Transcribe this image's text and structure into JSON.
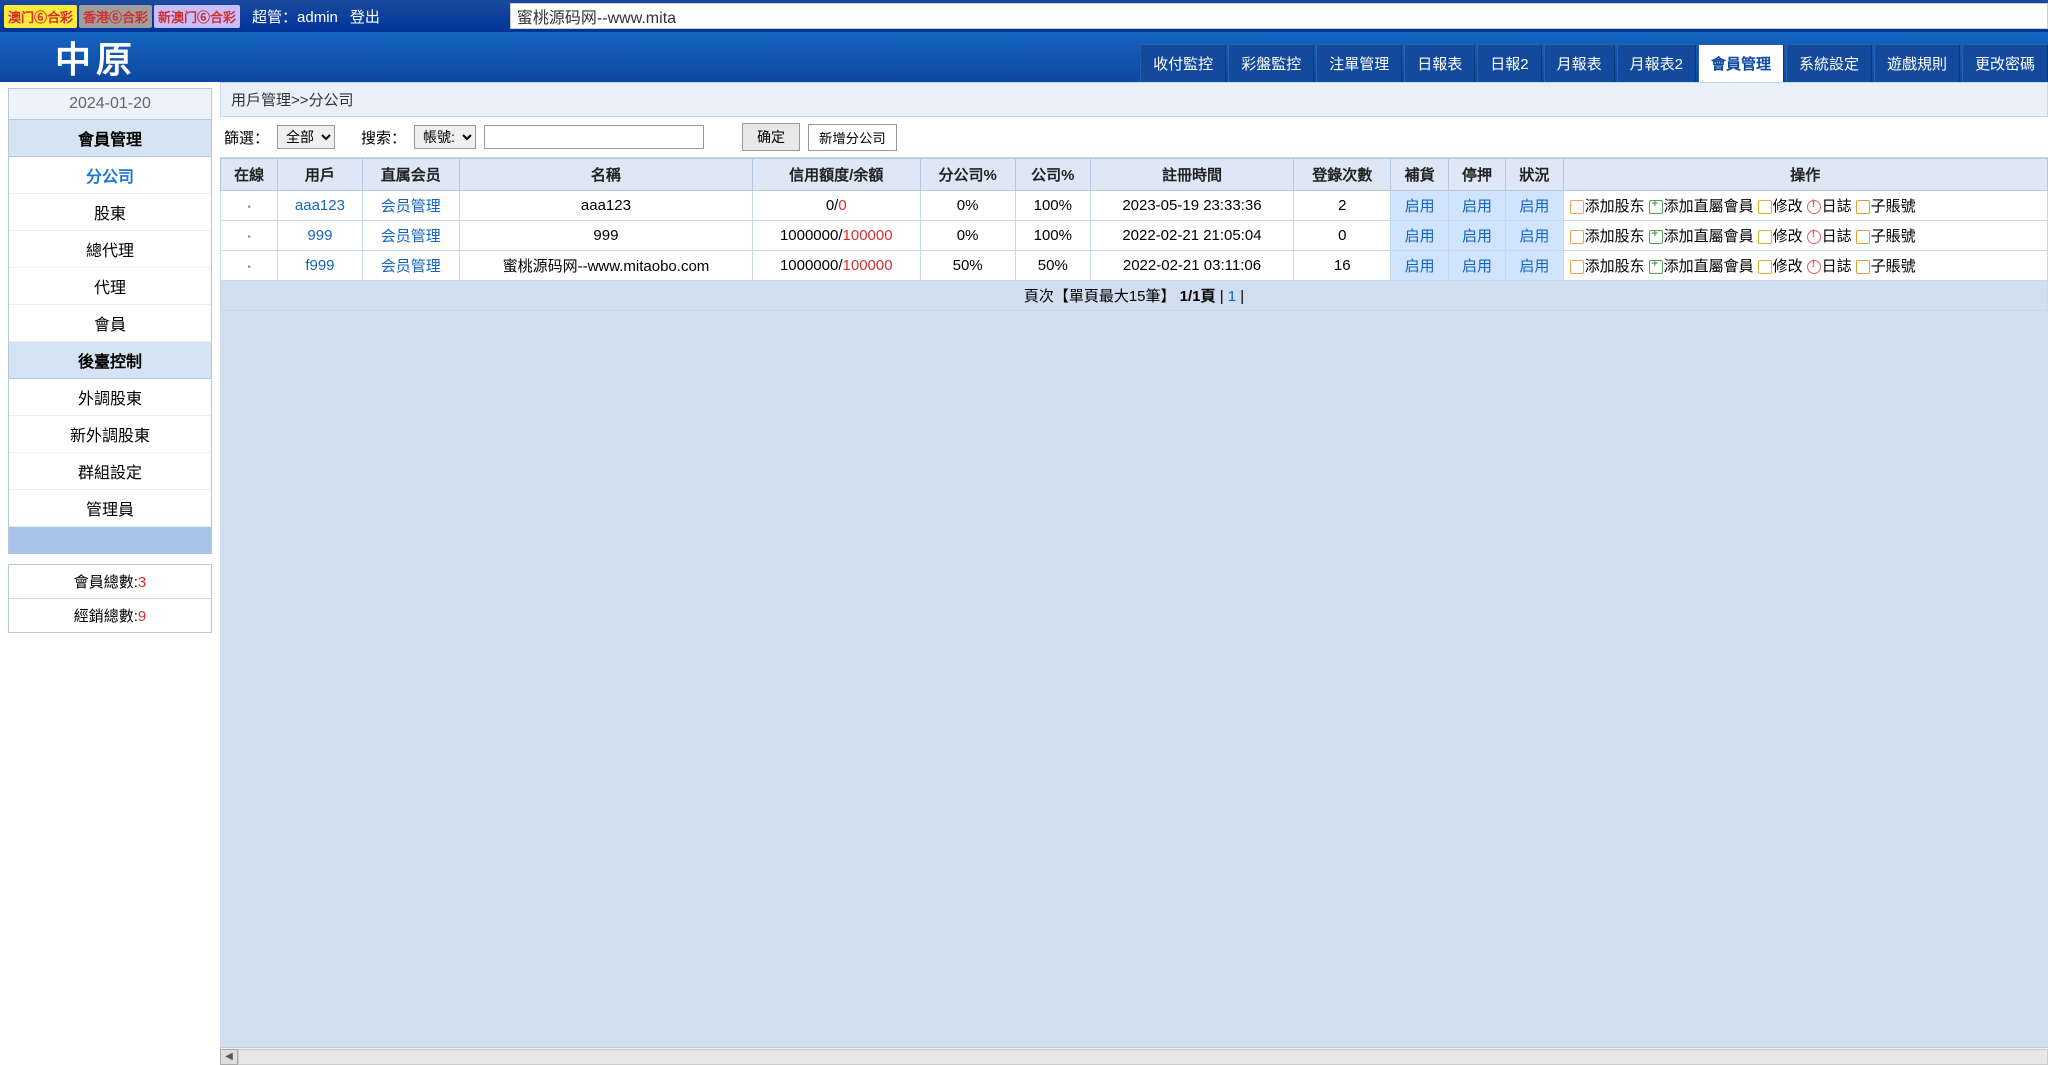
{
  "top": {
    "tags": [
      "澳门⑥合彩",
      "香港⑥合彩",
      "新澳门⑥合彩"
    ],
    "admin_label": "超管：admin",
    "logout": "登出",
    "search_value": "蜜桃源码网--www.mita"
  },
  "nav": {
    "logo": "中原",
    "tabs": [
      "收付監控",
      "彩盤監控",
      "注單管理",
      "日報表",
      "日報2",
      "月報表",
      "月報表2",
      "會員管理",
      "系統設定",
      "遊戲規則",
      "更改密碼"
    ],
    "active_index": 7
  },
  "sidebar": {
    "date": "2024-01-20",
    "member_header": "會員管理",
    "member_items": [
      "分公司",
      "股東",
      "總代理",
      "代理",
      "會員"
    ],
    "member_active": 0,
    "backend_header": "後臺控制",
    "backend_items": [
      "外調股東",
      "新外調股東",
      "群組設定",
      "管理員"
    ],
    "total_members_label": "會員總數:",
    "total_members": "3",
    "total_dealers_label": "經銷總數:",
    "total_dealers": "9"
  },
  "breadcrumb": "用戶管理>>分公司",
  "filter": {
    "filter_label": "篩選：",
    "filter_value": "全部",
    "search_label": "搜索：",
    "search_type": "帳號:",
    "confirm": "确定",
    "add_branch": "新增分公司"
  },
  "table": {
    "headers": [
      "在線",
      "用戶",
      "直属会员",
      "名稱",
      "信用額度/余額",
      "分公司%",
      "公司%",
      "註冊時間",
      "登錄次數",
      "補貨",
      "停押",
      "狀況",
      "操作"
    ],
    "rows": [
      {
        "online": "•",
        "user": "aaa123",
        "direct": "会员管理",
        "name": "aaa123",
        "credit": "0",
        "balance": "0",
        "branch_pct": "0%",
        "co_pct": "100%",
        "reg": "2023-05-19 23:33:36",
        "logins": "2",
        "buhuo": "启用",
        "tingya": "启用",
        "status": "启用"
      },
      {
        "online": "•",
        "user": "999",
        "direct": "会员管理",
        "name": "999",
        "credit": "1000000",
        "balance": "100000",
        "branch_pct": "0%",
        "co_pct": "100%",
        "reg": "2022-02-21 21:05:04",
        "logins": "0",
        "buhuo": "启用",
        "tingya": "启用",
        "status": "启用"
      },
      {
        "online": "•",
        "user": "f999",
        "direct": "会员管理",
        "name": "蜜桃源码网--www.mitaobo.com",
        "credit": "1000000",
        "balance": "100000",
        "branch_pct": "50%",
        "co_pct": "50%",
        "reg": "2022-02-21 03:11:06",
        "logins": "16",
        "buhuo": "启用",
        "tingya": "启用",
        "status": "启用"
      }
    ],
    "ops": {
      "add_share": "添加股东",
      "add_direct": "添加直屬會員",
      "edit": "修改",
      "log": "日誌",
      "sub": "子賬號"
    }
  },
  "pager": {
    "prefix": "頁次【單頁最大15筆】 ",
    "pages": "1/1頁",
    "sep": "   | ",
    "cur": "1",
    "end": " |"
  }
}
